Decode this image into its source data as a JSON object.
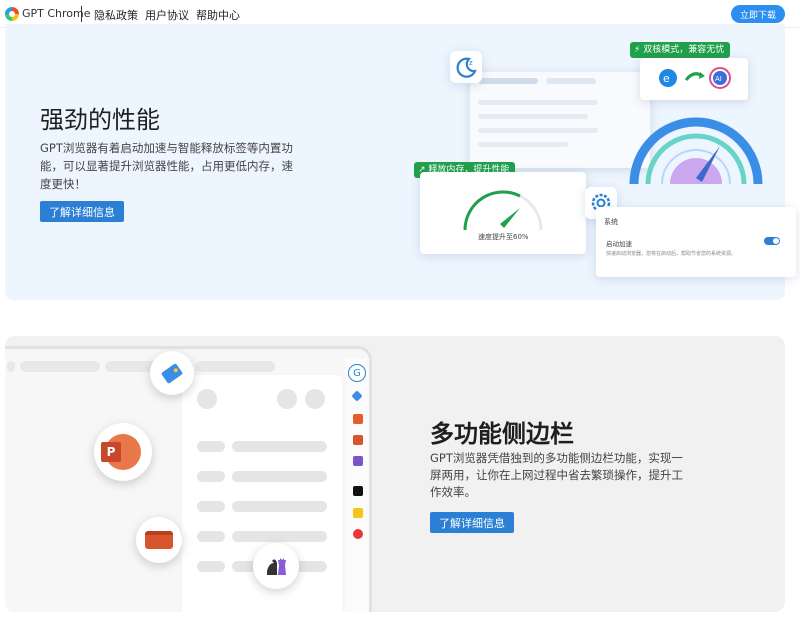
{
  "header": {
    "brand": "GPT Chrome",
    "nav": [
      "隐私政策",
      "用户协议",
      "帮助中心"
    ],
    "download_label": "立即下载"
  },
  "performance": {
    "title": "强劲的性能",
    "desc": "GPT浏览器有着启动加速与智能释放标签等内置功能，可以显著提升浏览器性能，占用更低内存，速度更快！",
    "button": "了解详细信息",
    "illustration": {
      "dual_core_tag": "双核模式，兼容无忧",
      "release_tag": "释放内存，提升性能",
      "speed_text": "速度提升至60%",
      "settings_title": "系统",
      "startup_label": "启动加速",
      "startup_desc": "快速启动浏览器，您将在启动后，帮助节省您的系统资源。",
      "ai_label": "AI"
    }
  },
  "sidebar_feature": {
    "title": "多功能侧边栏",
    "desc": "GPT浏览器凭借独到的多功能侧边栏功能，实现一屏两用，让你在上网过程中省去繁琐操作，提升工作效率。",
    "button": "了解详细信息",
    "ppt_letter": "P"
  },
  "colors": {
    "accent": "#2b7fd4",
    "download": "#2b8ef0",
    "section1_bg": "#edf5fe",
    "section2_bg": "#f1f1f1",
    "tag_green": "#21a04b"
  }
}
